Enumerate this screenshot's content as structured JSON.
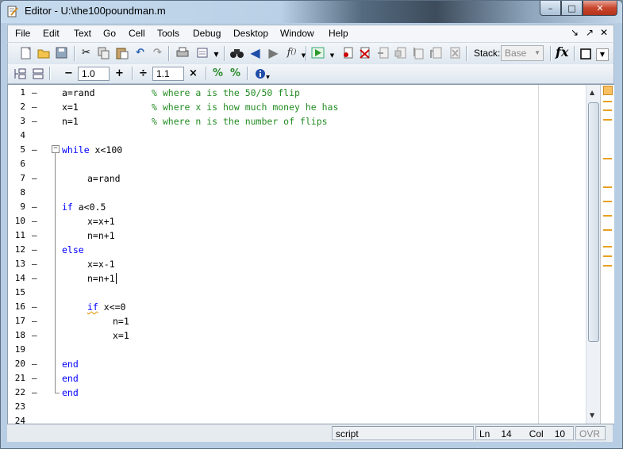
{
  "window": {
    "title": "Editor - U:\\the100poundman.m",
    "controls": {
      "minimize": "–",
      "maximize": "□",
      "close": "✕"
    }
  },
  "menubar": {
    "items": [
      "File",
      "Edit",
      "Text",
      "Go",
      "Cell",
      "Tools",
      "Debug",
      "Desktop",
      "Window",
      "Help"
    ],
    "right_controls": [
      "↘",
      "↗",
      "✕"
    ]
  },
  "toolbar": {
    "stack_label": "Stack:",
    "stack_value": "Base",
    "fx_label": "fx"
  },
  "cell_toolbar": {
    "minus": "−",
    "value1": "1.0",
    "plus": "+",
    "divide": "÷",
    "value2": "1.1",
    "times": "×"
  },
  "editor": {
    "lines": [
      {
        "n": "1",
        "dash": "–"
      },
      {
        "n": "2",
        "dash": "–"
      },
      {
        "n": "3",
        "dash": "–"
      },
      {
        "n": "4",
        "dash": ""
      },
      {
        "n": "5",
        "dash": "–"
      },
      {
        "n": "6",
        "dash": ""
      },
      {
        "n": "7",
        "dash": "–"
      },
      {
        "n": "8",
        "dash": ""
      },
      {
        "n": "9",
        "dash": "–"
      },
      {
        "n": "10",
        "dash": "–"
      },
      {
        "n": "11",
        "dash": "–"
      },
      {
        "n": "12",
        "dash": "–"
      },
      {
        "n": "13",
        "dash": "–"
      },
      {
        "n": "14",
        "dash": "–"
      },
      {
        "n": "15",
        "dash": ""
      },
      {
        "n": "16",
        "dash": "–"
      },
      {
        "n": "17",
        "dash": "–"
      },
      {
        "n": "18",
        "dash": "–"
      },
      {
        "n": "19",
        "dash": ""
      },
      {
        "n": "20",
        "dash": "–"
      },
      {
        "n": "21",
        "dash": "–"
      },
      {
        "n": "22",
        "dash": "–"
      },
      {
        "n": "23",
        "dash": ""
      },
      {
        "n": "24",
        "dash": ""
      }
    ],
    "code": {
      "l1_code": "a=rand",
      "l1_comment": "% where a is the 50/50 flip",
      "l2_code": "x=1",
      "l2_comment": "% where x is how much money he has",
      "l3_code": "n=1",
      "l3_comment": "% where n is the number of flips",
      "l5_kw": "while",
      "l5_rest": " x<100",
      "l7": "a=rand",
      "l9_kw": "if",
      "l9_rest": " a<0.5",
      "l10": "x=x+1",
      "l11": "n=n+1",
      "l12_kw": "else",
      "l13": "x=x-1",
      "l14": "n=n+1",
      "l16_kw": "if",
      "l16_rest": " x<=0",
      "l17": "n=1",
      "l18": "x=1",
      "l20_kw": "end",
      "l21_kw": "end",
      "l22_kw": "end"
    }
  },
  "statusbar": {
    "mode": "script",
    "ln_label": "Ln",
    "ln_value": "14",
    "col_label": "Col",
    "col_value": "10",
    "ovr": "OVR"
  }
}
